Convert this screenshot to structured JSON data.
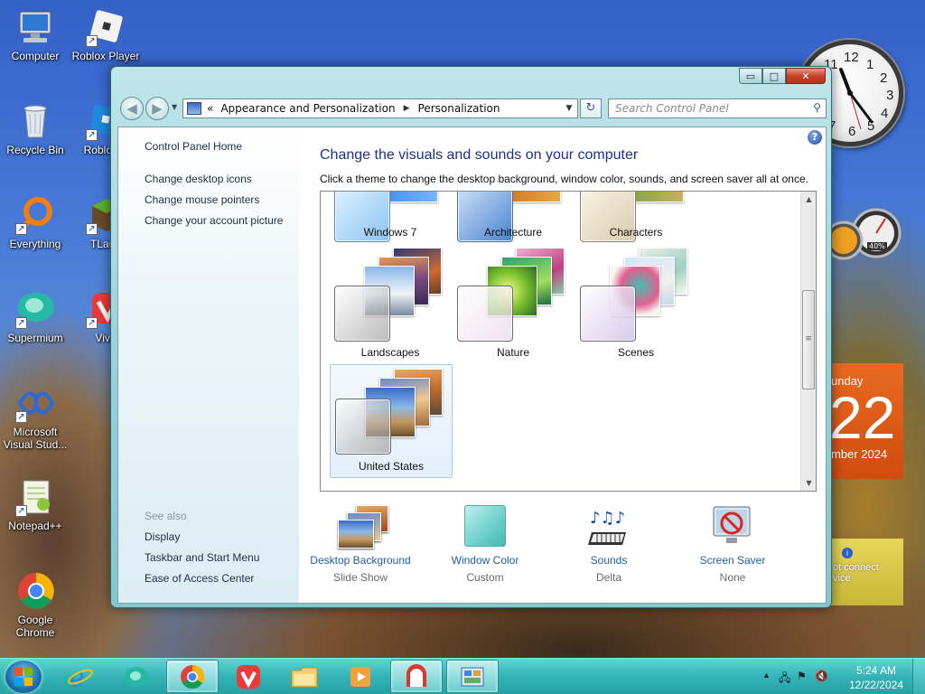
{
  "desktop": {
    "icons": [
      {
        "label": "Computer",
        "icon": "computer-icon"
      },
      {
        "label": "Roblox Player",
        "icon": "roblox-icon"
      },
      {
        "label": "Recycle Bin",
        "icon": "recycle-bin-icon"
      },
      {
        "label": "Roblox S",
        "icon": "roblox-studio-icon"
      },
      {
        "label": "Everything",
        "icon": "everything-search-icon"
      },
      {
        "label": "TLaun",
        "icon": "tlauncher-icon"
      },
      {
        "label": "Supermium",
        "icon": "supermium-icon"
      },
      {
        "label": "Viva",
        "icon": "vivaldi-icon"
      },
      {
        "label": "Microsoft Visual Stud...",
        "icon": "visual-studio-icon"
      },
      {
        "label": "Notepad++",
        "icon": "notepadpp-icon"
      },
      {
        "label": "Google Chrome",
        "icon": "chrome-icon"
      }
    ],
    "gadgets": {
      "clock": {
        "numerals": [
          "12",
          "3",
          "6",
          "9",
          "1",
          "2",
          "4",
          "5",
          "7",
          "8",
          "10",
          "11"
        ]
      },
      "cpu_meter": {
        "value": "40%"
      },
      "calendar": {
        "day_fragment": "unday",
        "date": "22",
        "month_fragment": "mber 2024"
      },
      "network": {
        "text_line1": "ot connect",
        "text_line2": "vice"
      }
    }
  },
  "window": {
    "caption_buttons": {
      "minimize": "▭",
      "maximize": "□",
      "close": "✕"
    },
    "navigation": {
      "back": "◀",
      "forward": "▶"
    },
    "address": {
      "chevron": "«",
      "crumbs": [
        "Appearance and Personalization",
        "Personalization"
      ],
      "separator": "▶",
      "dropdown": "▼"
    },
    "refresh": "↻",
    "search": {
      "placeholder": "Search Control Panel",
      "icon": "🔍"
    },
    "left_pane": {
      "home": "Control Panel Home",
      "links": [
        "Change desktop icons",
        "Change mouse pointers",
        "Change your account picture"
      ],
      "see_also_header": "See also",
      "see_also": [
        "Display",
        "Taskbar and Start Menu",
        "Ease of Access Center"
      ]
    },
    "main": {
      "help": "?",
      "title": "Change the visuals and sounds on your computer",
      "subtitle": "Click a theme to change the desktop background, window color, sounds, and screen saver all at once.",
      "themes": [
        {
          "name": "Windows 7"
        },
        {
          "name": "Architecture"
        },
        {
          "name": "Characters"
        },
        {
          "name": "Landscapes"
        },
        {
          "name": "Nature"
        },
        {
          "name": "Scenes"
        },
        {
          "name": "United States",
          "selected": true
        }
      ],
      "scroll": {
        "up": "▲",
        "down": "▼",
        "grip": "≡"
      },
      "footer": [
        {
          "link": "Desktop Background",
          "value": "Slide Show",
          "icon": "desktop-background-icon"
        },
        {
          "link": "Window Color",
          "value": "Custom",
          "icon": "window-color-icon"
        },
        {
          "link": "Sounds",
          "value": "Delta",
          "icon": "sounds-icon"
        },
        {
          "link": "Screen Saver",
          "value": "None",
          "icon": "screen-saver-icon"
        }
      ]
    }
  },
  "taskbar": {
    "pinned": [
      "internet-explorer-icon",
      "supermium-icon",
      "chrome-icon",
      "vivaldi-icon",
      "file-explorer-icon",
      "media-player-icon",
      "paint-icon",
      "control-panel-icon"
    ],
    "tray": {
      "expand": "▲",
      "time": "5:24 AM",
      "date": "12/22/2024"
    }
  },
  "colors": {
    "window_frame": "#95d0d8",
    "taskbar": "#34b4b6",
    "link": "#1e5ea8",
    "title": "#1e3287",
    "calendar": "#e05a18"
  }
}
